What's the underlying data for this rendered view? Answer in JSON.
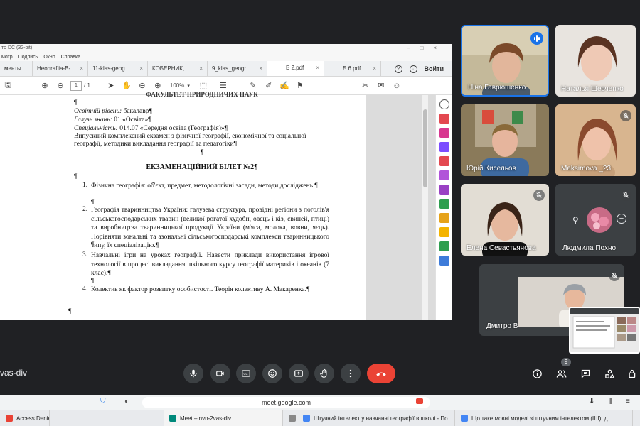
{
  "pdf": {
    "title": "то DC (32-bit)",
    "menu": [
      "мотр",
      "Подпись",
      "Окно",
      "Справка"
    ],
    "tabs": [
      {
        "label": "менты",
        "close": ""
      },
      {
        "label": "Heohrafiia-B-...",
        "close": "×"
      },
      {
        "label": "11-klas-geog...",
        "close": "×"
      },
      {
        "label": "КОБЕРНИК, ...",
        "close": "×"
      },
      {
        "label": "9_klas_geogr...",
        "close": "×"
      },
      {
        "label": "Б 2.pdf",
        "close": "×"
      },
      {
        "label": "Б 6.pdf",
        "close": "×"
      }
    ],
    "login": "Войти",
    "page_current": "1",
    "page_total": "/ 1",
    "zoom": "100%",
    "doc": {
      "top_cut": "ФАКУЛЬТЕТ ПРИРОДНИЧИХ НАУК",
      "pilcrow": "¶",
      "level_label": "Освітній рівень:",
      "level_value": " бакалавр¶",
      "field_label": "Галузь знань:",
      "field_value": " 01 «Освіта»¶",
      "spec_label": "Спеціальність:",
      "spec_value": " 014.07 «Середня освіта (Географія)»¶",
      "exam_line1": "Випускний комплексний екзамен з фізичної географії, економічної та соціальної",
      "exam_line2": "географії, методики викладання географії та педагогіки¶",
      "ticket_title": "ЕКЗАМЕНАЦІЙНИЙ БІЛЕТ №2¶",
      "items": [
        {
          "n": "1.",
          "text": "Фізична географія: об'єкт, предмет, методологічні засади, методи досліджень.¶"
        },
        {
          "n": "2.",
          "text": "Географія тваринництва України: галузева структура, провідні регіони з поголів'я сільськогосподарських тварин (великої рогатої худоби, овець і кіз, свиней, птиці) та виробництва тваринницької продукції України (м'яса, молока, вовни, яєць). Порівняти зональні та азональні сільськогосподарські комплекси тваринницького типу, їх спеціалізацію.¶"
        },
        {
          "n": "3.",
          "text": "Навчальні ігри на уроках географії. Навести приклади використання ігрової технології в процесі викладання шкільного курсу географії материків і океанів (7 клас).¶"
        },
        {
          "n": "4.",
          "text": "Колектив як фактор розвитку особистості. Теорія колективу А. Макаренка.¶"
        }
      ]
    }
  },
  "participants": [
    {
      "name": "Ніна Гаврюшенко",
      "state": "speaking"
    },
    {
      "name": "Наталья Шевченко",
      "state": "normal"
    },
    {
      "name": "Юрій Кисельов",
      "state": "normal"
    },
    {
      "name": "Maksimova _23",
      "state": "muted"
    },
    {
      "name": "Елена Севастьянова",
      "state": "muted"
    },
    {
      "name": "Людмила Похно",
      "state": "muted"
    },
    {
      "name": "Дмитро В",
      "state": "muted"
    }
  ],
  "meeting": {
    "code": "vas-div",
    "people_count": "9"
  },
  "browser": {
    "url": "meet.google.com"
  },
  "taskbar": [
    {
      "label": "Access Denied",
      "color": "#e94235"
    },
    {
      "label": "Meet – nvn-2vas-div",
      "color": "#00897b"
    },
    {
      "label": "",
      "color": ""
    },
    {
      "label": "Штучний інтелект у навчанні географії в школі - По...",
      "color": "#4285f4"
    },
    {
      "label": "Що таке мовні моделі зі штучним інтелектом (ШІ): д...",
      "color": "#4285f4"
    }
  ],
  "colors": {
    "bg": "#202124",
    "tile": "#3c4043",
    "end_call": "#ea4335",
    "speaking": "#1a73e8"
  }
}
